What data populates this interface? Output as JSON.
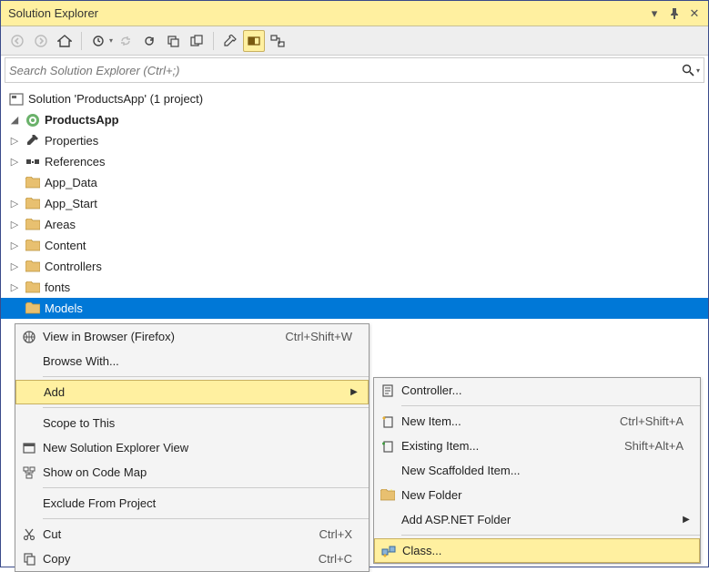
{
  "title": "Solution Explorer",
  "search_placeholder": "Search Solution Explorer (Ctrl+;)",
  "tree": {
    "solution": "Solution 'ProductsApp' (1 project)",
    "project": "ProductsApp",
    "items": {
      "properties": "Properties",
      "references": "References",
      "app_data": "App_Data",
      "app_start": "App_Start",
      "areas": "Areas",
      "content": "Content",
      "controllers": "Controllers",
      "fonts": "fonts",
      "models": "Models"
    }
  },
  "ctx1": {
    "view_browser": "View in Browser (Firefox)",
    "view_browser_sc": "Ctrl+Shift+W",
    "browse_with": "Browse With...",
    "add": "Add",
    "scope": "Scope to This",
    "new_view": "New Solution Explorer View",
    "code_map": "Show on Code Map",
    "exclude": "Exclude From Project",
    "cut": "Cut",
    "cut_sc": "Ctrl+X",
    "copy": "Copy",
    "copy_sc": "Ctrl+C"
  },
  "ctx2": {
    "controller": "Controller...",
    "new_item": "New Item...",
    "new_item_sc": "Ctrl+Shift+A",
    "existing_item": "Existing Item...",
    "existing_item_sc": "Shift+Alt+A",
    "scaffolded": "New Scaffolded Item...",
    "new_folder": "New Folder",
    "aspnet_folder": "Add ASP.NET Folder",
    "klass": "Class..."
  }
}
